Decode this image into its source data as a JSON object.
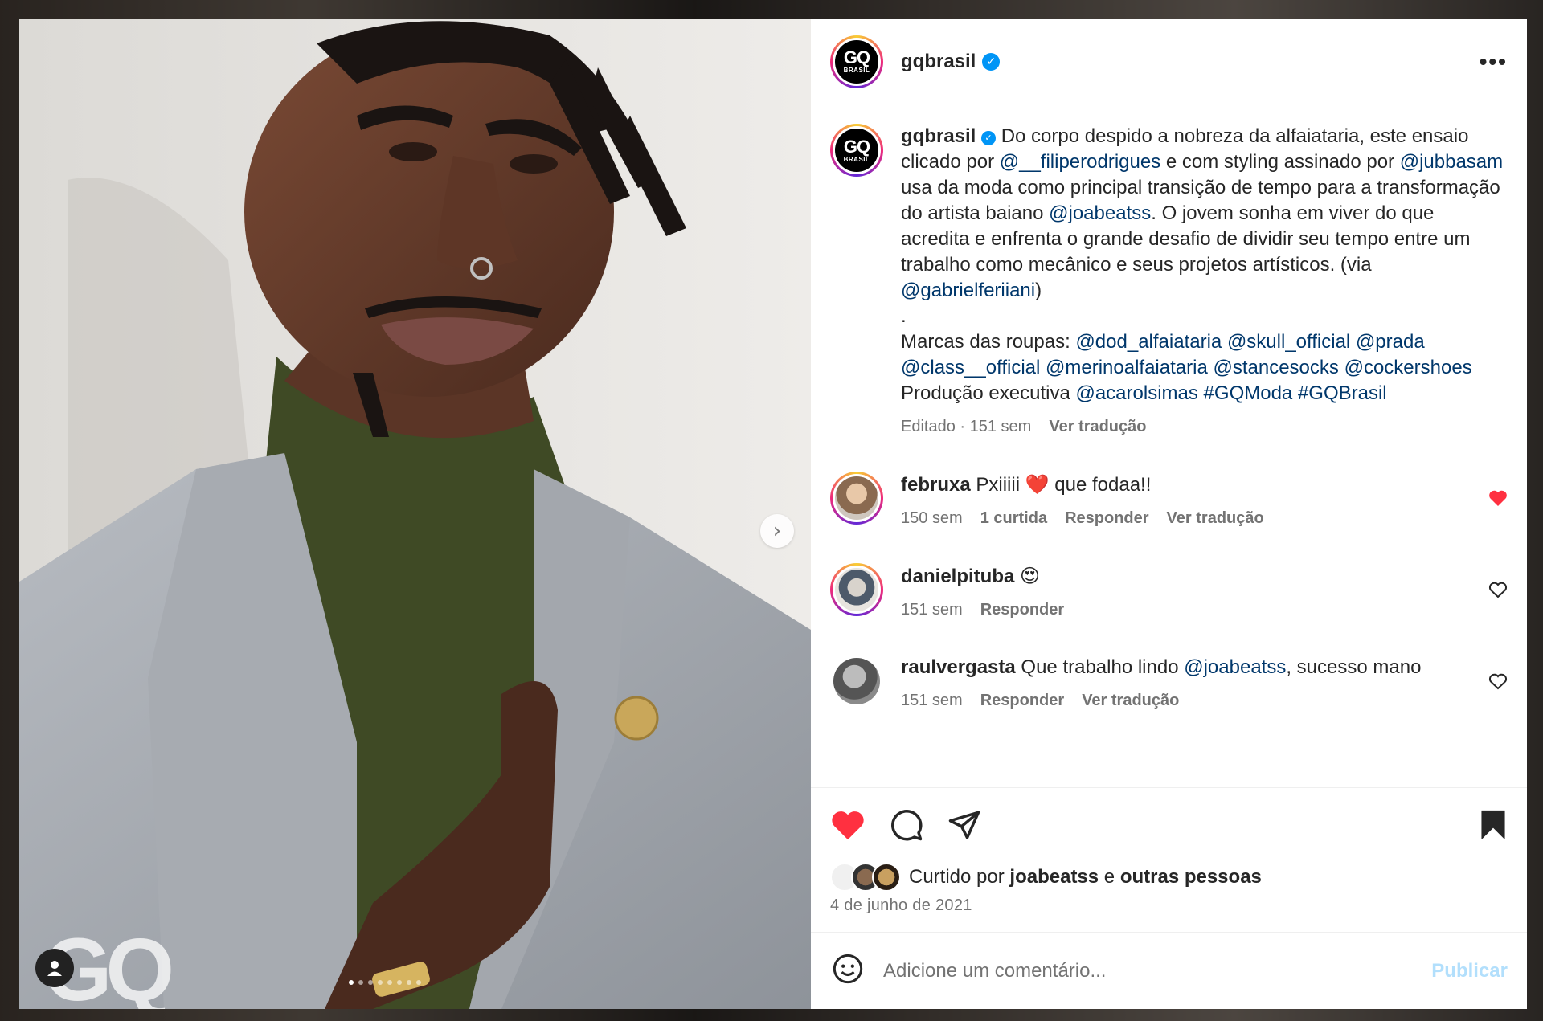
{
  "post": {
    "username": "gqbrasil",
    "more_label": "•••",
    "logo_main": "GQ",
    "logo_sub": "BRASIL",
    "watermark": "GQ",
    "next_label": "›"
  },
  "caption": {
    "username": "gqbrasil",
    "t1": "Do corpo despido a nobreza da alfaiataria, este ensaio clicado por ",
    "m1": "@__filiperodrigues",
    "t2": " e com styling assinado por ",
    "m2": "@jubbasam",
    "t3": " usa da moda como principal transição de tempo para a transformação do artista baiano ",
    "m3": "@joabeatss",
    "t4": ". O jovem sonha em viver do que acredita e enfrenta o grande desafio de dividir seu tempo entre um trabalho como mecânico e seus projetos artísticos. (via ",
    "m4": "@gabrielferiiani",
    "t5": ")",
    "dot": ".",
    "brands_label": "Marcas das roupas: ",
    "b1": "@dod_alfaiataria",
    "b2": "@skull_official",
    "b3": "@prada",
    "b4": "@class__official",
    "b5": "@merinoalfaiataria",
    "b6": "@stancesocks",
    "b7": "@cockershoes",
    "prod_label": " Produção executiva ",
    "b8": "@acarolsimas",
    "h1": "#GQModa",
    "h2": "#GQBrasil",
    "edited": "Editado · 151 sem",
    "translate": "Ver tradução"
  },
  "comments": [
    {
      "username": "februxa",
      "text_before": " Pxiiiii ",
      "emoji": "❤️",
      "text_after": " que fodaa!!",
      "time": "150 sem",
      "likes": "1 curtida",
      "reply": "Responder",
      "translate": "Ver tradução",
      "liked": true
    },
    {
      "username": "danielpituba",
      "emoji": "😍",
      "time": "151 sem",
      "reply": "Responder",
      "liked": false
    },
    {
      "username": "raulvergasta",
      "text_before": " Que trabalho lindo ",
      "mention": "@joabeatss",
      "text_after": ", sucesso mano",
      "time": "151 sem",
      "reply": "Responder",
      "translate": "Ver tradução",
      "liked": false
    }
  ],
  "footer": {
    "liked_by_prefix": "Curtido por ",
    "liked_by_user": "joabeatss",
    "liked_by_and": " e ",
    "liked_by_others": "outras pessoas",
    "date": "4 de junho de 2021",
    "comment_placeholder": "Adicione um comentário...",
    "publish": "Publicar"
  },
  "carousel": {
    "count": 8,
    "active_index": 0
  },
  "icons": [
    "heart-icon",
    "comment-icon",
    "share-icon",
    "bookmark-icon",
    "emoji-icon",
    "verified-icon",
    "more-icon",
    "user-tag-icon",
    "chevron-right-icon"
  ],
  "colors": {
    "like_red": "#ff3040",
    "link_blue": "#00376b",
    "verified_blue": "#0095f6",
    "publish_disabled": "#b2dffc"
  }
}
